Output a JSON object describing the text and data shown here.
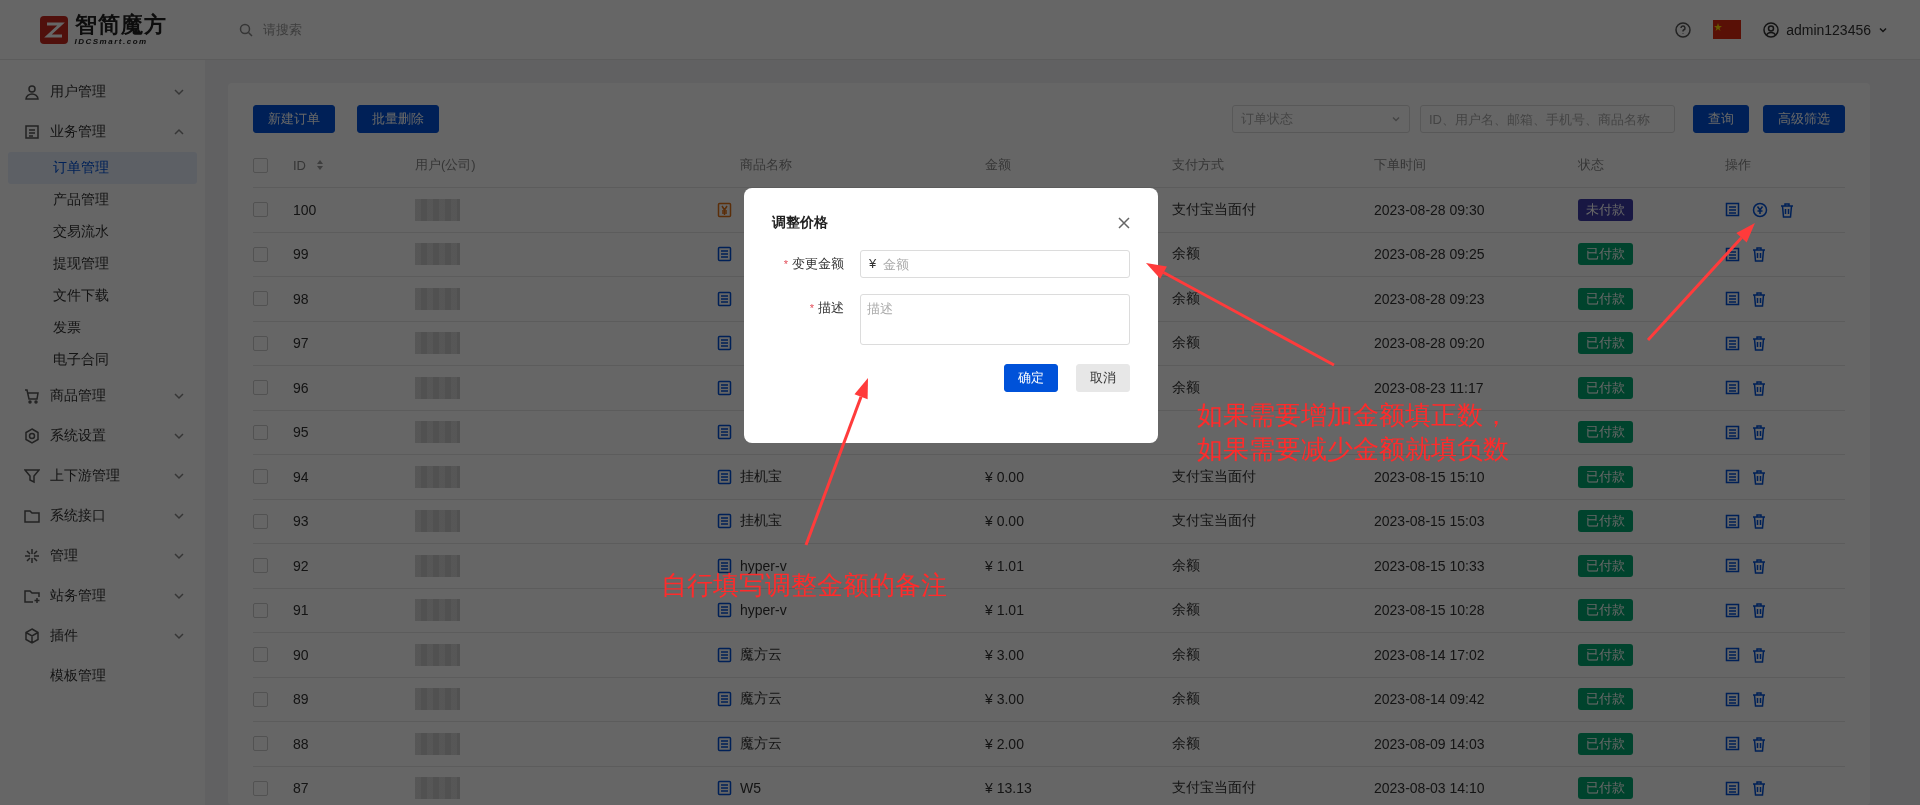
{
  "header": {
    "logo_text": "智简魔方",
    "logo_subtext": "IDCSmart.com",
    "search": {
      "placeholder": "请搜索"
    },
    "user": "admin123456"
  },
  "sidebar": {
    "items": [
      {
        "label": "用户管理",
        "kind": "group",
        "expanded": false,
        "selected": false
      },
      {
        "label": "业务管理",
        "kind": "group",
        "expanded": true,
        "selected": false,
        "children": [
          {
            "label": "订单管理",
            "selected": true
          },
          {
            "label": "产品管理",
            "selected": false
          },
          {
            "label": "交易流水",
            "selected": false
          },
          {
            "label": "提现管理",
            "selected": false
          },
          {
            "label": "文件下载",
            "selected": false
          },
          {
            "label": "发票",
            "selected": false
          },
          {
            "label": "电子合同",
            "selected": false
          }
        ]
      },
      {
        "label": "商品管理",
        "kind": "group",
        "expanded": false,
        "selected": false
      },
      {
        "label": "系统设置",
        "kind": "group",
        "expanded": false,
        "selected": false
      },
      {
        "label": "上下游管理",
        "kind": "group",
        "expanded": false,
        "selected": false
      },
      {
        "label": "系统接口",
        "kind": "group",
        "expanded": false,
        "selected": false
      },
      {
        "label": "管理",
        "kind": "group",
        "expanded": false,
        "selected": false
      },
      {
        "label": "站务管理",
        "kind": "group",
        "expanded": false,
        "selected": false
      },
      {
        "label": "插件",
        "kind": "group",
        "expanded": false,
        "selected": false
      },
      {
        "label": "模板管理",
        "kind": "link",
        "selected": false
      }
    ]
  },
  "toolbar": {
    "buttons": [
      "新建订单",
      "批量删除"
    ],
    "status_select": {
      "placeholder": "订单状态"
    },
    "search": {
      "placeholder": "ID、用户名、邮箱、手机号、商品名称"
    },
    "actions": [
      "查询",
      "高级筛选"
    ]
  },
  "table": {
    "select_all": {
      "checked": false
    },
    "columns": [
      "ID",
      "用户(公司)",
      "商品名称",
      "金额",
      "支付方式",
      "下单时间",
      "状态",
      "操作"
    ],
    "rows": [
      {
        "id": "100",
        "recharge": true,
        "payment": "支付宝当面付",
        "time": "2023-08-28 09:30",
        "status": {
          "label": "未付款",
          "kind": "unpaid"
        },
        "price_adjustable": true,
        "checked": false
      },
      {
        "id": "99",
        "recharge": false,
        "payment": "余额",
        "time": "2023-08-28 09:25",
        "status": {
          "label": "已付款",
          "kind": "paid"
        },
        "price_adjustable": false,
        "checked": false
      },
      {
        "id": "98",
        "recharge": false,
        "payment": "余额",
        "time": "2023-08-28 09:23",
        "status": {
          "label": "已付款",
          "kind": "paid"
        },
        "price_adjustable": false,
        "checked": false
      },
      {
        "id": "97",
        "recharge": false,
        "payment": "余额",
        "time": "2023-08-28 09:20",
        "status": {
          "label": "已付款",
          "kind": "paid"
        },
        "price_adjustable": false,
        "checked": false
      },
      {
        "id": "96",
        "recharge": false,
        "payment": "余额",
        "time": "2023-08-23 11:17",
        "status": {
          "label": "已付款",
          "kind": "paid"
        },
        "price_adjustable": false,
        "checked": false
      },
      {
        "id": "95",
        "recharge": false,
        "status": {
          "label": "已付款",
          "kind": "paid"
        },
        "price_adjustable": false,
        "checked": false
      },
      {
        "id": "94",
        "recharge": false,
        "product": "挂机宝",
        "amount": "¥ 0.00",
        "payment": "支付宝当面付",
        "time": "2023-08-15 15:10",
        "status": {
          "label": "已付款",
          "kind": "paid"
        },
        "price_adjustable": false,
        "checked": false
      },
      {
        "id": "93",
        "recharge": false,
        "product": "挂机宝",
        "amount": "¥ 0.00",
        "payment": "支付宝当面付",
        "time": "2023-08-15 15:03",
        "status": {
          "label": "已付款",
          "kind": "paid"
        },
        "price_adjustable": false,
        "checked": false
      },
      {
        "id": "92",
        "recharge": false,
        "product": "hyper-v",
        "amount": "¥ 1.01",
        "payment": "余额",
        "time": "2023-08-15 10:33",
        "status": {
          "label": "已付款",
          "kind": "paid"
        },
        "price_adjustable": false,
        "checked": false
      },
      {
        "id": "91",
        "recharge": false,
        "product": "hyper-v",
        "amount": "¥ 1.01",
        "payment": "余额",
        "time": "2023-08-15 10:28",
        "status": {
          "label": "已付款",
          "kind": "paid"
        },
        "price_adjustable": false,
        "checked": false
      },
      {
        "id": "90",
        "recharge": false,
        "product": "魔方云",
        "amount": "¥ 3.00",
        "payment": "余额",
        "time": "2023-08-14 17:02",
        "status": {
          "label": "已付款",
          "kind": "paid"
        },
        "price_adjustable": false,
        "checked": false
      },
      {
        "id": "89",
        "recharge": false,
        "product": "魔方云",
        "amount": "¥ 3.00",
        "payment": "余额",
        "time": "2023-08-14 09:42",
        "status": {
          "label": "已付款",
          "kind": "paid"
        },
        "price_adjustable": false,
        "checked": false
      },
      {
        "id": "88",
        "recharge": false,
        "product": "魔方云",
        "amount": "¥ 2.00",
        "payment": "余额",
        "time": "2023-08-09 14:03",
        "status": {
          "label": "已付款",
          "kind": "paid"
        },
        "price_adjustable": false,
        "checked": false
      },
      {
        "id": "87",
        "recharge": false,
        "product": "W5",
        "amount": "¥ 13.13",
        "payment": "支付宝当面付",
        "time": "2023-08-03 14:10",
        "status": {
          "label": "已付款",
          "kind": "paid"
        },
        "price_adjustable": false,
        "checked": false
      }
    ]
  },
  "dialog": {
    "title": "调整价格",
    "fields": [
      {
        "label": "变更金额",
        "kind": "input",
        "required_mark": "*",
        "prefix": "¥",
        "placeholder": "金额"
      },
      {
        "label": "描述",
        "kind": "textarea",
        "required_mark": "*",
        "placeholder": "描述"
      }
    ],
    "buttons": [
      {
        "label": "确定",
        "kind": "primary"
      },
      {
        "label": "取消",
        "kind": "secondary"
      }
    ]
  },
  "annotations": [
    {
      "lines": [
        "如果需要增加金额填正数，",
        "如果需要减少金额就填负数"
      ]
    },
    {
      "lines": [
        "自行填写调整金额的备注"
      ]
    }
  ]
}
